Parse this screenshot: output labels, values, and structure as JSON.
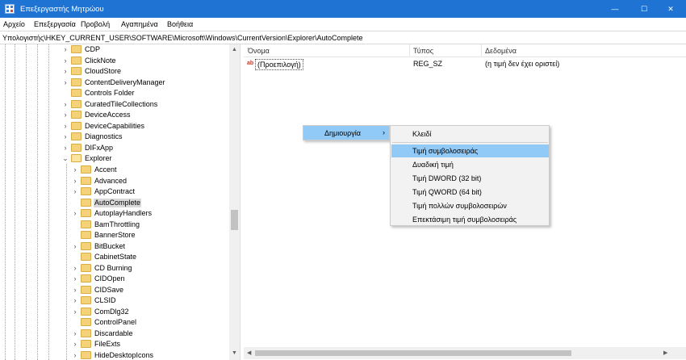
{
  "window": {
    "title": "Επεξεργαστής Μητρώου",
    "minimize_glyph": "—",
    "maximize_glyph": "☐",
    "close_glyph": "✕"
  },
  "menubar": {
    "items": [
      "Αρχείο",
      "Επεξεργασία",
      "Προβολή",
      "Αγαπημένα",
      "Βοήθεια"
    ]
  },
  "address": {
    "path": "Υπολογιστής\\HKEY_CURRENT_USER\\SOFTWARE\\Microsoft\\Windows\\CurrentVersion\\Explorer\\AutoComplete"
  },
  "tree": {
    "collapsed_glyph": "›",
    "expanded_glyph": "⌄",
    "level1": [
      "CDP",
      "ClickNote",
      "CloudStore",
      "ContentDeliveryManager",
      "Controls Folder",
      "CuratedTileCollections",
      "DeviceAccess",
      "DeviceCapabilities",
      "Diagnostics",
      "DIFxApp",
      "Explorer"
    ],
    "level2": [
      "Accent",
      "Advanced",
      "AppContract",
      "AutoComplete",
      "AutoplayHandlers",
      "BamThrottling",
      "BannerStore",
      "BitBucket",
      "CabinetState",
      "CD Burning",
      "CIDOpen",
      "CIDSave",
      "CLSID",
      "ComDlg32",
      "ControlPanel",
      "Discardable",
      "FileExts",
      "HideDesktopIcons"
    ],
    "selected": "AutoComplete"
  },
  "list": {
    "columns": [
      "Όνομα",
      "Τύπος",
      "Δεδομένα"
    ],
    "rows": [
      {
        "icon": "ab",
        "name": "(Προεπιλογή)",
        "type": "REG_SZ",
        "data": "(η τιμή δεν έχει οριστεί)"
      }
    ]
  },
  "context_menu": {
    "new_label": "Δημιουργία",
    "new_arrow": "›",
    "submenu": [
      "Κλειδί",
      "Τιμή συμβολοσειράς",
      "Δυαδική τιμή",
      "Τιμή DWORD (32 bit)",
      "Τιμή QWORD (64 bit)",
      "Τιμή πολλών συμβολοσειρών",
      "Επεκτάσιμη τιμή συμβολοσειράς"
    ],
    "highlighted": "Τιμή συμβολοσειράς"
  },
  "scroll": {
    "up": "▲",
    "down": "▼",
    "left": "◀",
    "right": "▶"
  },
  "colors": {
    "titlebar": "#1e73d3",
    "menu_highlight": "#91c9f7",
    "folder": "#f3d27a"
  }
}
